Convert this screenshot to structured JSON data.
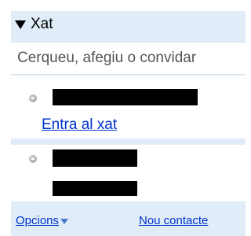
{
  "chat": {
    "title": "Xat",
    "search_placeholder": "Cerqueu, afegiu o convidar"
  },
  "contacts": [
    {
      "name": "[redacted]",
      "status": "offline",
      "action_link": "Entra al xat"
    },
    {
      "name": "[redacted]",
      "status": "offline"
    }
  ],
  "footer": {
    "options_label": "Opcions",
    "new_contact_label": "Nou contacte"
  },
  "icons": [
    "collapse-triangle-icon",
    "offline-status-icon",
    "dropdown-arrow-icon"
  ],
  "colors": {
    "panel_bg": "#e0ecf8",
    "link": "#0033cc"
  }
}
